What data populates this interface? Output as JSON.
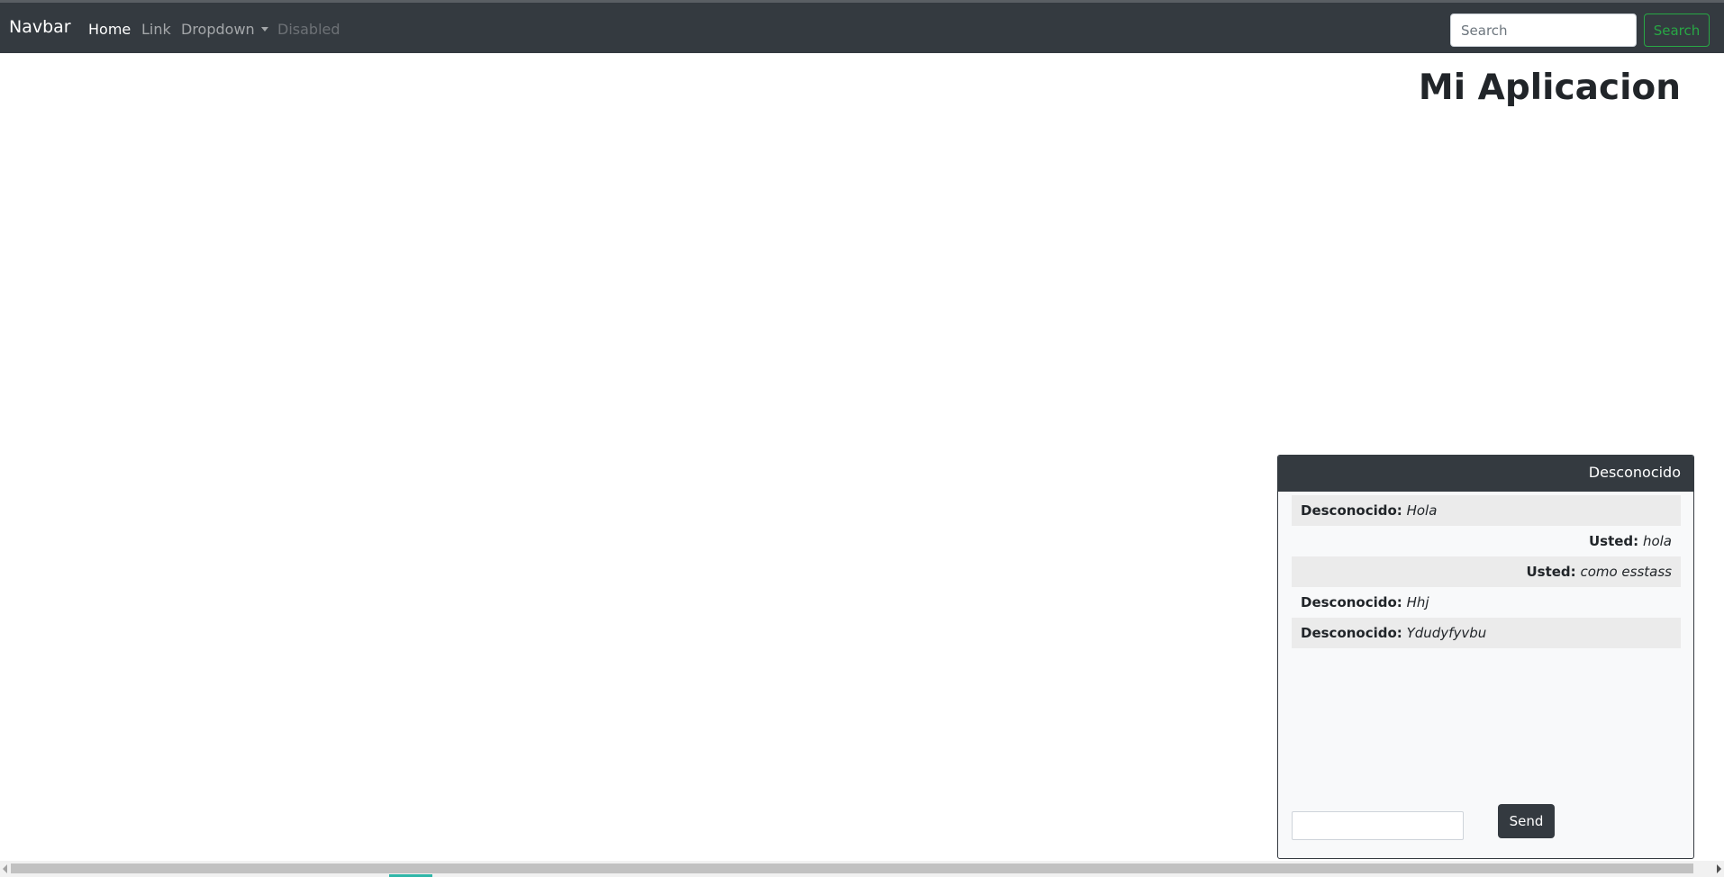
{
  "navbar": {
    "brand": "Navbar",
    "links": [
      {
        "label": "Home",
        "state": "active"
      },
      {
        "label": "Link",
        "state": "normal"
      },
      {
        "label": "Dropdown",
        "state": "normal"
      },
      {
        "label": "Disabled",
        "state": "disabled"
      }
    ],
    "search": {
      "placeholder": "Search",
      "value": "",
      "button_label": "Search"
    }
  },
  "main": {
    "title": "Mi Aplicacion"
  },
  "chat": {
    "header": "Desconocido",
    "messages": [
      {
        "sender": "Desconocido:",
        "text": "Hola",
        "align": "left"
      },
      {
        "sender": "Usted:",
        "text": "hola",
        "align": "right"
      },
      {
        "sender": "Usted:",
        "text": "como esstass",
        "align": "right"
      },
      {
        "sender": "Desconocido:",
        "text": "Hhj",
        "align": "left"
      },
      {
        "sender": "Desconocido:",
        "text": "Ydudyfyvbu",
        "align": "left"
      }
    ],
    "input_value": "",
    "send_label": "Send"
  },
  "colors": {
    "navbar_bg": "#343a40",
    "search_accent": "#28a745",
    "chat_body_bg": "#f8f9fa",
    "message_shade": "#ebebeb"
  },
  "icons": {
    "dropdown": "chevron-down-icon",
    "scroll_left": "arrow-left-icon",
    "scroll_right": "arrow-right-icon"
  }
}
